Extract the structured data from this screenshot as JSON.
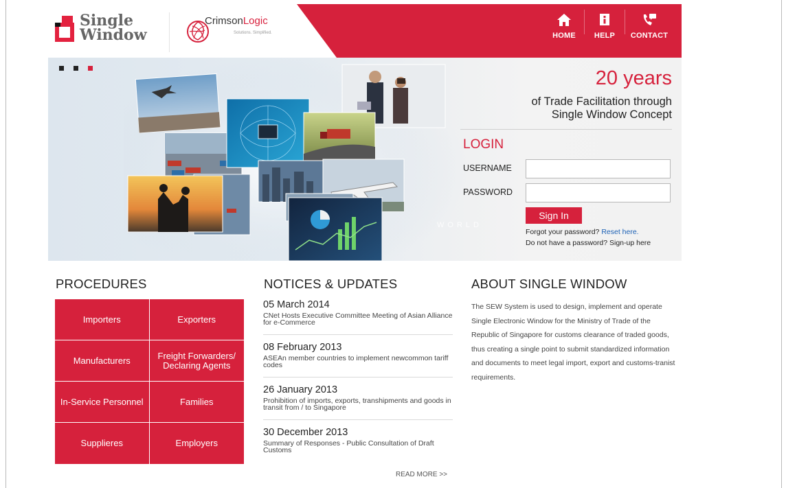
{
  "header": {
    "logo_single": "Single",
    "logo_window": "Window",
    "logo_crimson_a": "Crimson",
    "logo_crimson_b": "Logic",
    "logo_tagline": "Solutions. Simplified.",
    "nav": [
      {
        "label": "HOME",
        "icon": "home-icon"
      },
      {
        "label": "HELP",
        "icon": "info-icon"
      },
      {
        "label": "CONTACT",
        "icon": "phone-icon"
      }
    ],
    "accent": "#d6213c"
  },
  "banner": {
    "slides": 3,
    "active_slide": 3,
    "headline": "20 years",
    "sub1": "of Trade Facilitation through",
    "sub2": "Single Window Concept",
    "collage_text": "WORLD"
  },
  "login": {
    "title": "LOGIN",
    "username_label": "USERNAME",
    "password_label": "PASSWORD",
    "username_value": "",
    "password_value": "",
    "signin_label": "Sign In",
    "forgot_text": "Forgot your password?",
    "reset_link": "Reset here.",
    "nopass_text": "Do not have a password? Sign-up here"
  },
  "procedures": {
    "title": "PROCEDURES",
    "items": [
      "Importers",
      "Exporters",
      "Manufacturers",
      "Freight Forwarders/ Declaring Agents",
      "In-Service Personnel",
      "Families",
      "Supplieres",
      "Employers"
    ]
  },
  "notices": {
    "title": "NOTICES & UPDATES",
    "items": [
      {
        "date": "05 March 2014",
        "desc": "CNet Hosts Executive Committee Meeting of Asian Alliance for e-Commerce"
      },
      {
        "date": "08 February 2013",
        "desc": "ASEAn member countries to implement newcommon tariff codes"
      },
      {
        "date": "26 January 2013",
        "desc": "Prohibition of imports, exports, transhipments and goods in transit from / to Singapore"
      },
      {
        "date": "30 December 2013",
        "desc": "Summary of Responses - Public Consultation of Draft Customs"
      }
    ],
    "read_more": "READ MORE >>"
  },
  "about": {
    "title": "ABOUT SINGLE WINDOW",
    "text": "The SEW System is used to design, implement and operate Single Electronic Window for the Ministry of Trade of the Republic of Singapore for customs clearance of traded goods, thus creating a single point to submit standardized information and documents to meet legal import, export and customs-tranist requirements."
  }
}
